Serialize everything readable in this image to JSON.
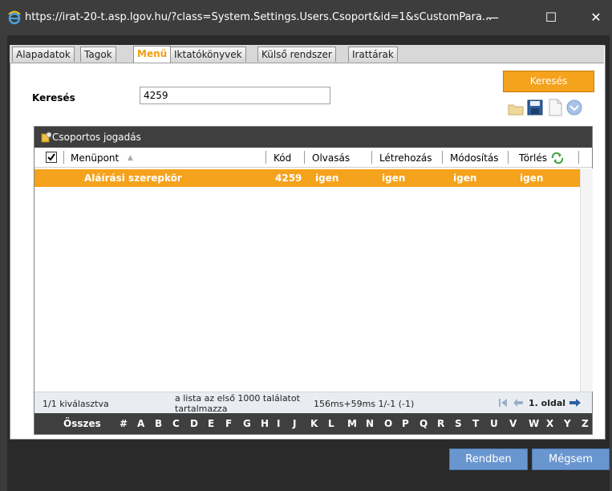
{
  "titlebar": {
    "url": "https://irat-20-t.asp.lgov.hu/?class=System.Settings.Users.Csoport&id=1&sCustomPara...",
    "minimize": "—",
    "maximize": "☐",
    "close": "✕"
  },
  "tabs": [
    {
      "label": "Alapadatok",
      "active": false
    },
    {
      "label": "Tagok",
      "active": false
    },
    {
      "label": "Menü",
      "active": true
    },
    {
      "label": "Iktatókönyvek",
      "active": false
    },
    {
      "label": "Külső rendszer",
      "active": false
    },
    {
      "label": "Irattárak",
      "active": false
    }
  ],
  "search": {
    "label": "Keresés",
    "value": "4259",
    "button_label": "Keresés"
  },
  "toolbar_icons": [
    "folder-icon",
    "save-icon",
    "new-document-icon",
    "dropdown-icon"
  ],
  "grid": {
    "title": "Csoportos jogadás",
    "columns": [
      "Menüpont",
      "Kód",
      "Olvasás",
      "Létrehozás",
      "Módosítás",
      "Törlés"
    ],
    "sort_indicator": "▲",
    "rows": [
      {
        "menupont": "Aláírási szerepkör",
        "kod": "4259",
        "olvasas": "igen",
        "letrehozas": "igen",
        "modositas": "igen",
        "torles": "igen",
        "selected": true
      }
    ]
  },
  "status": {
    "selection": "1/1 kiválasztva",
    "limit_note_line1": "a lista az első 1000 találatot",
    "limit_note_line2": "tartalmazza",
    "timing": "156ms+59ms 1/-1 (-1)",
    "page": "1. oldal"
  },
  "alphabet": {
    "all_label": "Összes",
    "letters": [
      "#",
      "A",
      "B",
      "C",
      "D",
      "E",
      "F",
      "G",
      "H",
      "I",
      "J",
      "K",
      "L",
      "M",
      "N",
      "O",
      "P",
      "Q",
      "R",
      "S",
      "T",
      "U",
      "V",
      "W",
      "X",
      "Y",
      "Z"
    ]
  },
  "buttons": {
    "ok": "Rendben",
    "cancel": "Mégsem"
  },
  "colors": {
    "accent": "#f5a21c",
    "button_blue": "#6a96cf",
    "header_dark": "#3f3f3f"
  }
}
